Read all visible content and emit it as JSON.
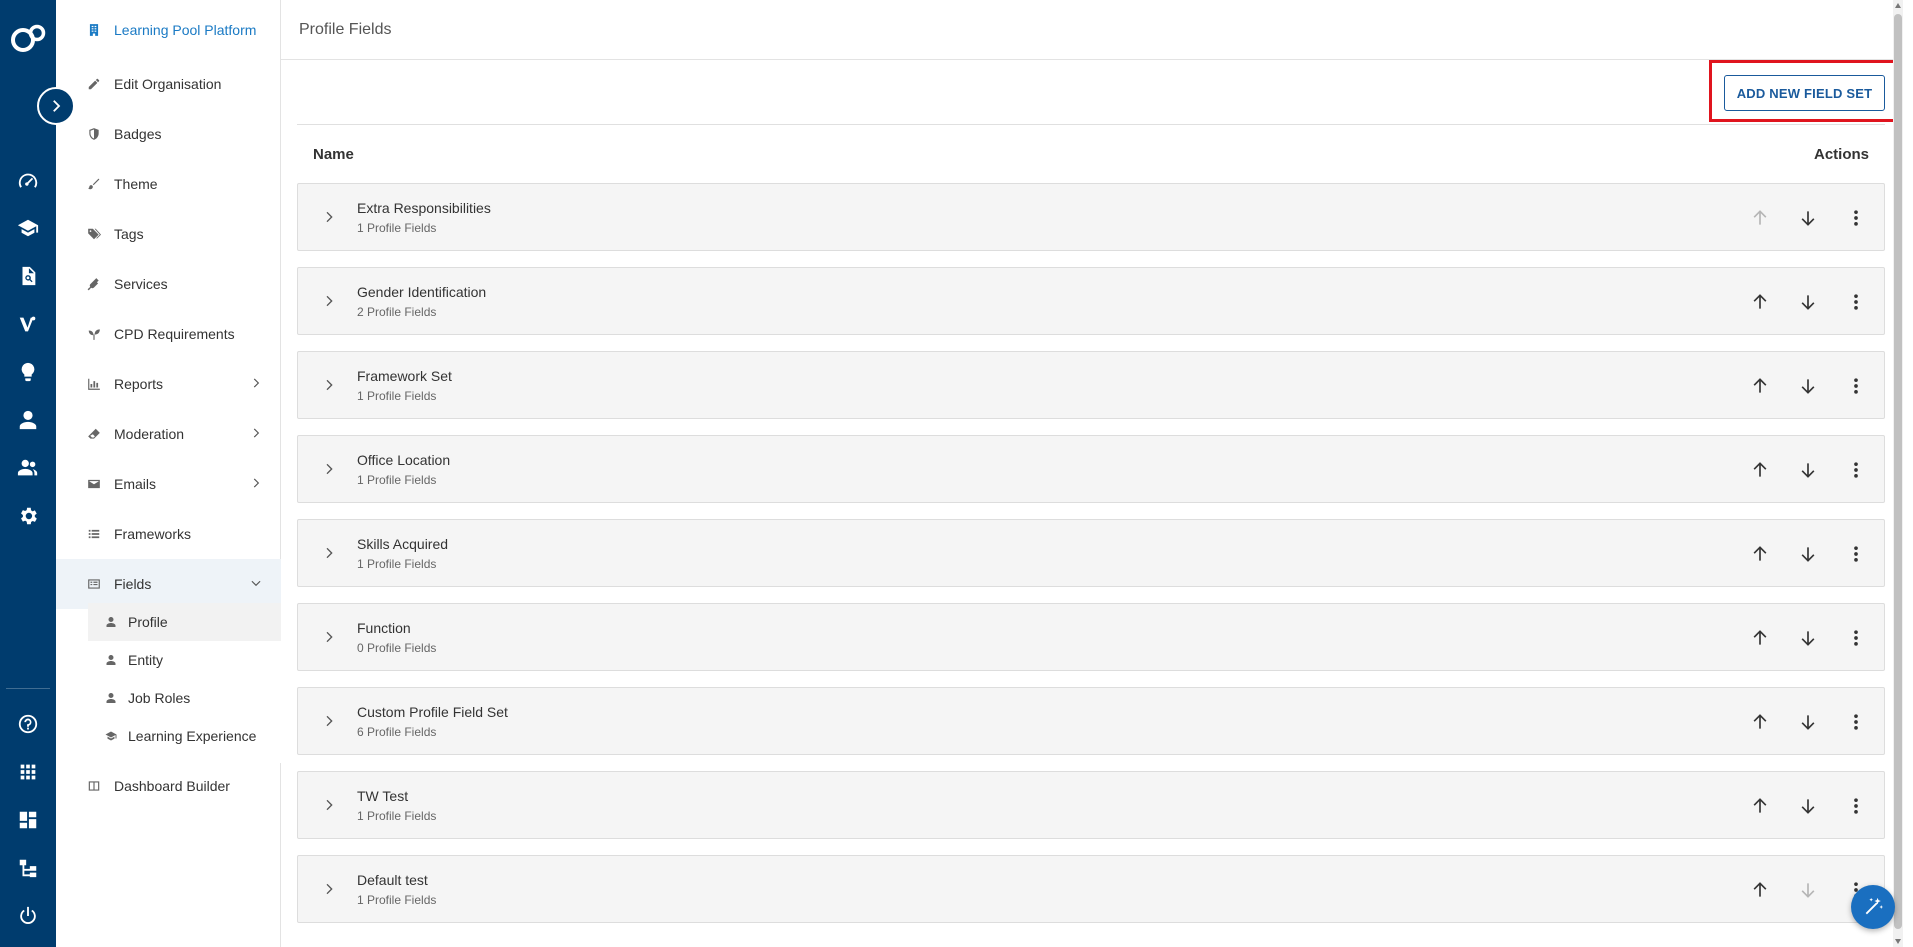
{
  "header": {
    "title": "Profile Fields"
  },
  "toolbar": {
    "add_label": "ADD NEW FIELD SET"
  },
  "table": {
    "col_name": "Name",
    "col_actions": "Actions"
  },
  "sidebar": {
    "brand": "Learning Pool Platform",
    "items": [
      {
        "label": "Edit Organisation",
        "icon": "pencil-icon"
      },
      {
        "label": "Badges",
        "icon": "shield-icon"
      },
      {
        "label": "Theme",
        "icon": "brush-icon"
      },
      {
        "label": "Tags",
        "icon": "tags-icon"
      },
      {
        "label": "Services",
        "icon": "plug-icon"
      },
      {
        "label": "CPD Requirements",
        "icon": "seedling-icon"
      },
      {
        "label": "Reports",
        "icon": "bar-chart-icon"
      },
      {
        "label": "Moderation",
        "icon": "eraser-icon"
      },
      {
        "label": "Emails",
        "icon": "envelope-icon"
      },
      {
        "label": "Frameworks",
        "icon": "list-icon"
      },
      {
        "label": "Fields",
        "icon": "list-alt-icon"
      },
      {
        "label": "Dashboard Builder",
        "icon": "columns-icon"
      }
    ],
    "fields_sub": [
      {
        "label": "Profile",
        "icon": "user-icon"
      },
      {
        "label": "Entity",
        "icon": "user-icon"
      },
      {
        "label": "Job Roles",
        "icon": "user-icon"
      },
      {
        "label": "Learning Experience",
        "icon": "graduation-cap-icon"
      }
    ]
  },
  "rows": [
    {
      "name": "Extra Responsibilities",
      "count": "1 Profile Fields",
      "up_disabled": true,
      "down_disabled": false
    },
    {
      "name": "Gender Identification",
      "count": "2 Profile Fields",
      "up_disabled": false,
      "down_disabled": false
    },
    {
      "name": "Framework Set",
      "count": "1 Profile Fields",
      "up_disabled": false,
      "down_disabled": false
    },
    {
      "name": "Office Location",
      "count": "1 Profile Fields",
      "up_disabled": false,
      "down_disabled": false
    },
    {
      "name": "Skills Acquired",
      "count": "1 Profile Fields",
      "up_disabled": false,
      "down_disabled": false
    },
    {
      "name": "Function",
      "count": "0 Profile Fields",
      "up_disabled": false,
      "down_disabled": false
    },
    {
      "name": "Custom Profile Field Set",
      "count": "6 Profile Fields",
      "up_disabled": false,
      "down_disabled": false
    },
    {
      "name": "TW Test",
      "count": "1 Profile Fields",
      "up_disabled": false,
      "down_disabled": false
    },
    {
      "name": "Default test",
      "count": "1 Profile Fields",
      "up_disabled": false,
      "down_disabled": true
    }
  ],
  "colors": {
    "rail": "#003c6e",
    "brand": "#1a7ac4",
    "button": "#1a5a9c",
    "highlight": "#e0141e",
    "fab": "#1a6fc0"
  }
}
